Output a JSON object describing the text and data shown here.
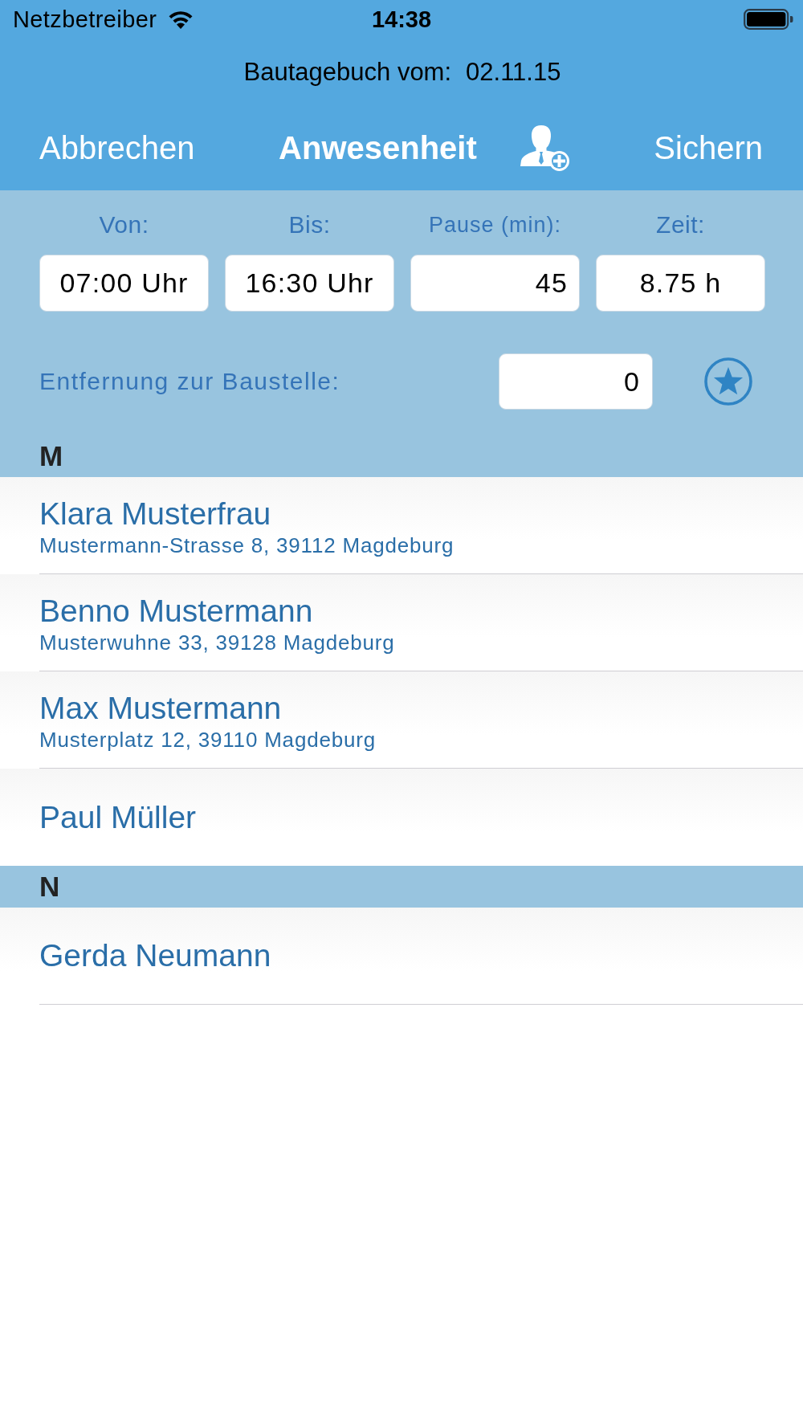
{
  "status_bar": {
    "carrier": "Netzbetreiber",
    "time": "14:38"
  },
  "header": {
    "title": "Bautagebuch vom:",
    "date": "02.11.15"
  },
  "nav_bar": {
    "cancel": "Abbrechen",
    "title": "Anwesenheit",
    "save": "Sichern"
  },
  "time_fields": [
    {
      "kind": "time",
      "label": "Von:",
      "value": "07:00 Uhr"
    },
    {
      "kind": "time",
      "label": "Bis:",
      "value": "16:30 Uhr"
    },
    {
      "kind": "minutes",
      "label": "Pause (min):",
      "value": "45"
    },
    {
      "kind": "hours",
      "label": "Zeit:",
      "value": "8.75 h"
    }
  ],
  "distance": {
    "label": "Entfernung zur Baustelle:",
    "value": "0"
  },
  "sections": [
    {
      "letter": "M",
      "people": [
        {
          "name": "Klara Musterfrau",
          "address": "Mustermann-Strasse 8, 39112 Magdeburg"
        },
        {
          "name": "Benno Mustermann",
          "address": "Musterwuhne 33, 39128 Magdeburg"
        },
        {
          "name": "Max Mustermann",
          "address": "Musterplatz 12, 39110 Magdeburg"
        },
        {
          "name": "Paul Müller"
        }
      ]
    },
    {
      "letter": "N",
      "people": [
        {
          "name": "Gerda Neumann"
        }
      ]
    }
  ]
}
